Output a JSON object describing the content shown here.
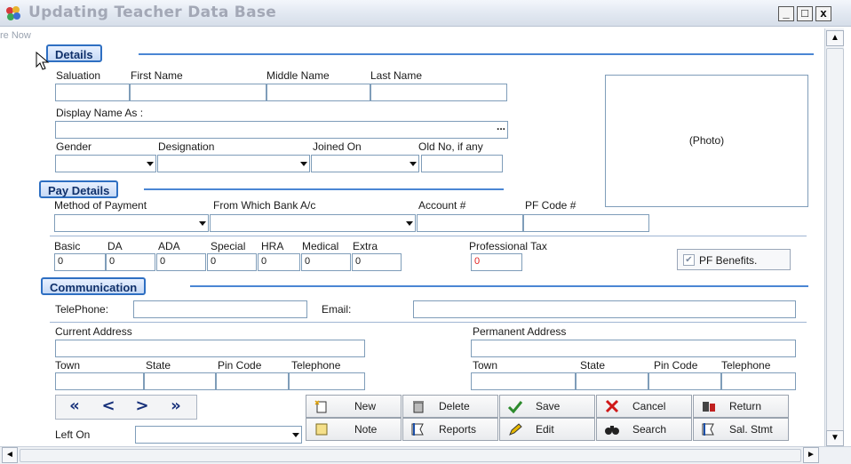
{
  "window": {
    "title": "Updating Teacher Data Base",
    "min_label": "_",
    "max_label": "□",
    "close_label": "x",
    "ghost_text": "re Now"
  },
  "details": {
    "section_label": "Details",
    "salutation_label": "Saluation",
    "first_name_label": "First Name",
    "middle_name_label": "Middle Name",
    "last_name_label": "Last Name",
    "display_name_label": "Display Name As :",
    "ellipsis": "...",
    "gender_label": "Gender",
    "designation_label": "Designation",
    "joined_on_label": "Joined On",
    "old_no_label": "Old No, if any",
    "photo_label": "(Photo)"
  },
  "pay": {
    "section_label": "Pay Details",
    "method_label": "Method of Payment",
    "bank_label": "From Which Bank A/c",
    "account_label": "Account #",
    "pf_code_label": "PF Code #",
    "basic_label": "Basic",
    "da_label": "DA",
    "ada_label": "ADA",
    "special_label": "Special",
    "hra_label": "HRA",
    "medical_label": "Medical",
    "extra_label": "Extra",
    "professional_tax_label": "Professional Tax",
    "basic": "0",
    "da": "0",
    "ada": "0",
    "special": "0",
    "hra": "0",
    "medical": "0",
    "extra": "0",
    "professional_tax": "0",
    "pf_benefits_label": "PF Benefits.",
    "pf_benefits_checked": true
  },
  "communication": {
    "section_label": "Communication",
    "telephone_label": "TelePhone:",
    "email_label": "Email:",
    "current_address_label": "Current Address",
    "permanent_address_label": "Permanent Address",
    "town_label": "Town",
    "state_label": "State",
    "pin_code_label": "Pin Code",
    "telephone_col_label": "Telephone"
  },
  "footer": {
    "left_on_label": "Left On",
    "nav": [
      "«",
      "<",
      ">",
      "»"
    ]
  },
  "actions": {
    "new": "New",
    "delete": "Delete",
    "save": "Save",
    "cancel": "Cancel",
    "return": "Return",
    "note": "Note",
    "reports": "Reports",
    "edit": "Edit",
    "search": "Search",
    "sal_stmt": "Sal. Stmt"
  },
  "colors": {
    "accent": "#2e6fc2",
    "field_border": "#7f9db9",
    "tax_value": "#e02020"
  }
}
